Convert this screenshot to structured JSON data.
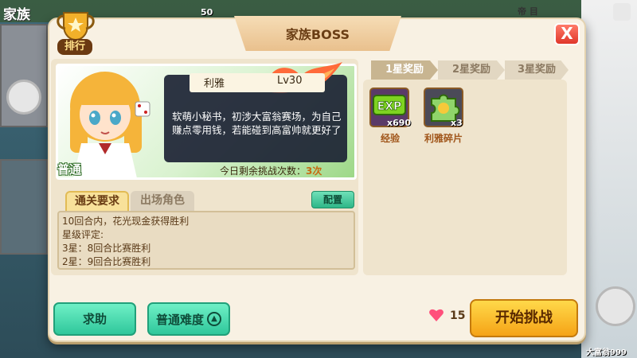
{
  "background": {
    "family_label": "家族",
    "top_count": "50",
    "top_right_label": "帝 目",
    "bottom_right_label": "大富翁999"
  },
  "modal": {
    "title": "家族BOSS",
    "close_label": "X"
  },
  "ranking": {
    "label": "排行"
  },
  "boss": {
    "name": "利雅",
    "level": "Lv30",
    "mode": "普通",
    "description": "软萌小秘书，初涉大富翁赛场，为自己赚点零用钱，若能碰到高富帅就更好了",
    "attempts_prefix": "今日剩余挑战次数：",
    "attempts_value": "3次"
  },
  "tabs": {
    "requirements": "通关要求",
    "roles": "出场角色",
    "config": "配置"
  },
  "requirements": {
    "lines": [
      "10回合内，花光现金获得胜利",
      "星级评定:",
      "3星：8回合比赛胜利",
      "2星：9回合比赛胜利"
    ]
  },
  "reward_tabs": [
    "1星奖励",
    "2星奖励",
    "3星奖励"
  ],
  "rewards": [
    {
      "icon": "exp-icon",
      "icon_text": "EXP",
      "count": "x690",
      "label": "经验"
    },
    {
      "icon": "puzzle-shard-icon",
      "count": "x3",
      "label": "利雅碎片"
    }
  ],
  "footer": {
    "help": "求助",
    "difficulty": "普通难度",
    "stamina": "15",
    "start": "开始挑战"
  },
  "colors": {
    "accent_green": "#2fc79b",
    "accent_yellow": "#f5a316",
    "close_red": "#e0372a",
    "heart_pink": "#ff4f7b"
  }
}
